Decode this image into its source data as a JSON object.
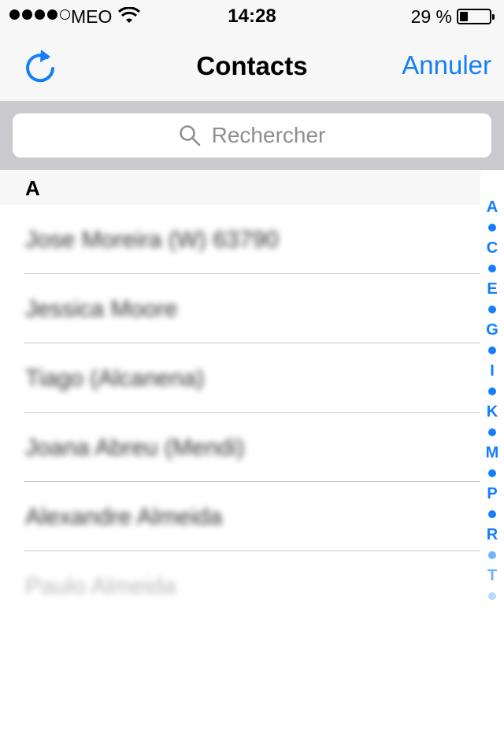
{
  "status_bar": {
    "carrier": "MEO",
    "time": "14:28",
    "battery_percent_label": "29 %",
    "battery_level": 0.29,
    "signal_bars_filled": 4,
    "signal_bars_total": 5
  },
  "nav": {
    "title": "Contacts",
    "cancel_label": "Annuler",
    "refresh_icon": "refresh-icon"
  },
  "search": {
    "placeholder": "Rechercher",
    "icon": "search-icon"
  },
  "section": {
    "letter": "A"
  },
  "contacts": [
    {
      "name": "Jose Moreira (W) 63790"
    },
    {
      "name": "Jessica Moore"
    },
    {
      "name": "Tiago (Alcanena)"
    },
    {
      "name": "Joana Abreu (Mendi)"
    },
    {
      "name": "Alexandre Almeida"
    },
    {
      "name": "Paulo Almeida"
    }
  ],
  "index": [
    "A",
    "•",
    "C",
    "•",
    "E",
    "•",
    "G",
    "•",
    "I",
    "•",
    "K",
    "•",
    "M",
    "•",
    "P",
    "•",
    "R",
    "•",
    "T",
    "•"
  ],
  "colors": {
    "accent": "#157efb",
    "bar_background": "#f7f7f7",
    "search_background": "#c9c9ce"
  }
}
